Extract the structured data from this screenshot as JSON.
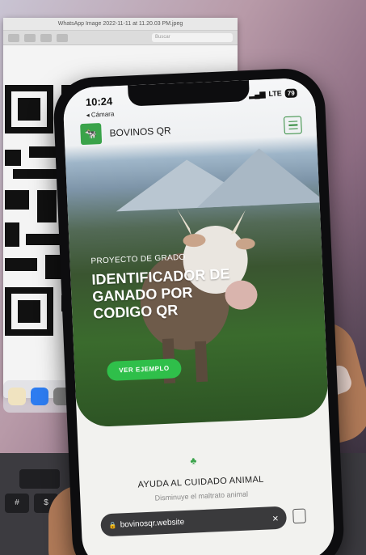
{
  "background_window": {
    "title": "WhatsApp Image 2022-11-11 at 11.20.03 PM.jpeg",
    "search_placeholder": "Buscar"
  },
  "phone": {
    "status": {
      "time": "10:24",
      "network": "LTE",
      "battery": "79"
    },
    "back_link": "◂ Cámara",
    "site": {
      "brand": "BOVINOS QR",
      "eyebrow": "PROYECTO DE GRADO",
      "headline": "IDENTIFICADOR DE GANADO POR CODIGO QR",
      "cta_label": "VER EJEMPLO",
      "section_title": "AYUDA AL CUIDADO ANIMAL",
      "section_subtitle": "Disminuye el maltrato animal"
    },
    "browser": {
      "url": "bovinosqr.website",
      "close_label": "×"
    }
  },
  "colors": {
    "accent_green": "#2fbf4a",
    "brand_green": "#3aa34a",
    "urlbar": "#3a3a3c"
  },
  "keyboard": {
    "keys": [
      "#",
      "$",
      "4"
    ]
  }
}
